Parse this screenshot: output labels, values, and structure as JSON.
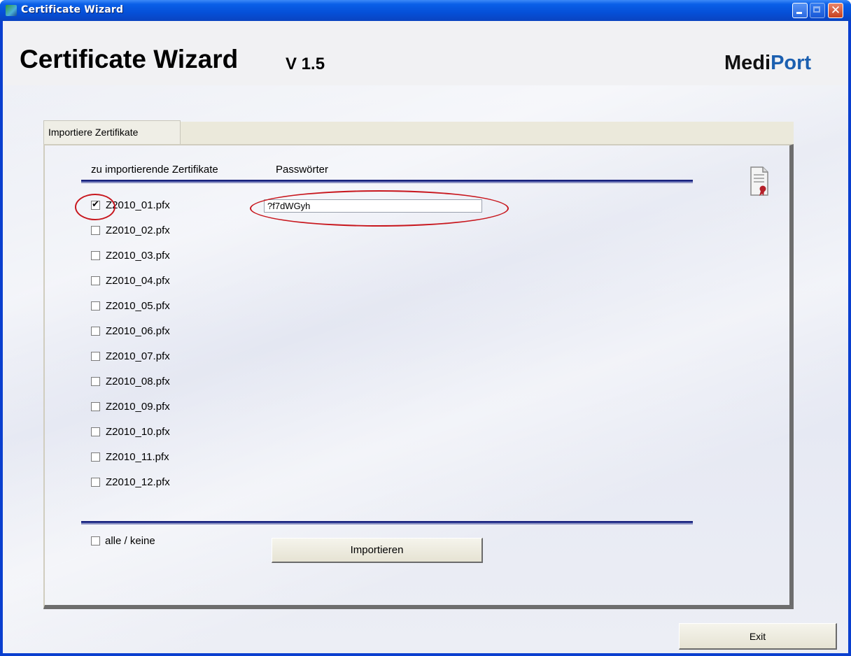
{
  "window": {
    "title": "Certificate Wizard",
    "controls": [
      "minimize",
      "maximize",
      "close"
    ]
  },
  "header": {
    "app_title": "Certificate Wizard",
    "version": "V 1.5",
    "brand_part1": "Medi",
    "brand_part2": "Port"
  },
  "tabs": [
    {
      "label": "Importiere  Zertifikate",
      "selected": true
    }
  ],
  "import_panel": {
    "col_certificates": "zu importierende Zertifikate",
    "col_passwords": "Passwörter",
    "certificates": [
      {
        "label": "Z2010_01.pfx",
        "checked": true,
        "password": "?f7dWGyh"
      },
      {
        "label": "Z2010_02.pfx",
        "checked": false
      },
      {
        "label": "Z2010_03.pfx",
        "checked": false
      },
      {
        "label": "Z2010_04.pfx",
        "checked": false
      },
      {
        "label": "Z2010_05.pfx",
        "checked": false
      },
      {
        "label": "Z2010_06.pfx",
        "checked": false
      },
      {
        "label": "Z2010_07.pfx",
        "checked": false
      },
      {
        "label": "Z2010_08.pfx",
        "checked": false
      },
      {
        "label": "Z2010_09.pfx",
        "checked": false
      },
      {
        "label": "Z2010_10.pfx",
        "checked": false
      },
      {
        "label": "Z2010_11.pfx",
        "checked": false
      },
      {
        "label": "Z2010_12.pfx",
        "checked": false
      }
    ],
    "select_all_label": "alle / keine",
    "select_all_checked": false,
    "import_button": "Importieren"
  },
  "exit_button": "Exit",
  "colors": {
    "annotation": "#c8171e",
    "rule": "#1a237e",
    "brand_accent": "#1b5fb0"
  }
}
